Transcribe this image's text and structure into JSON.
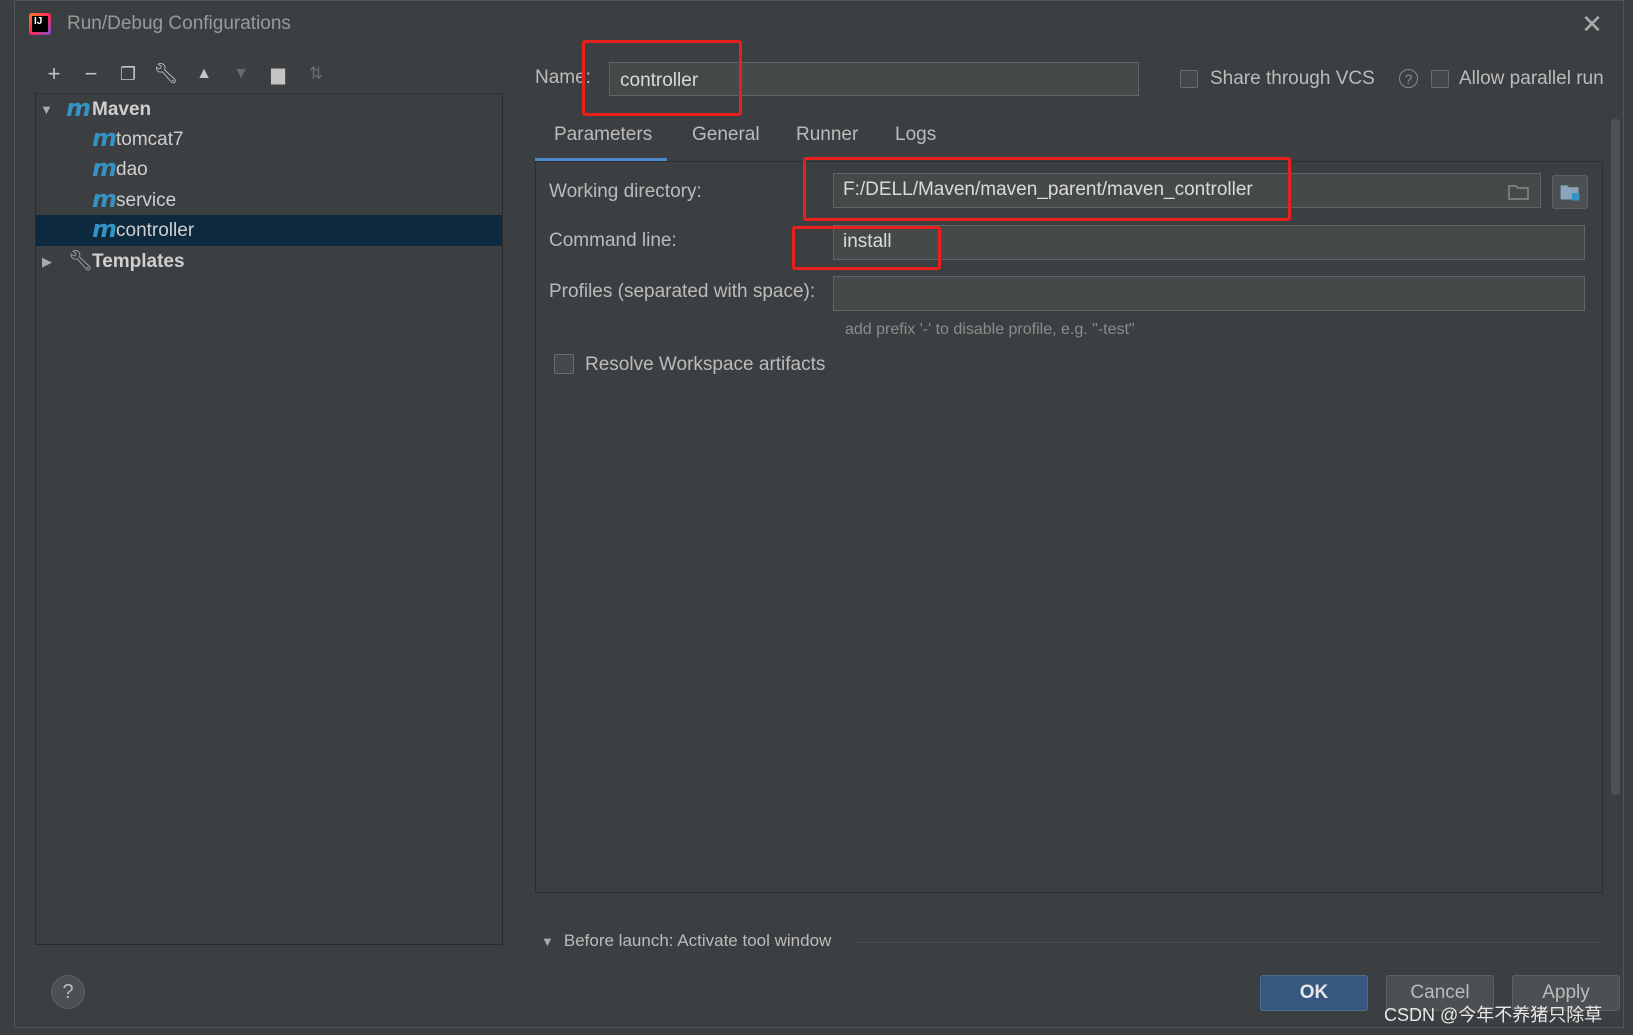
{
  "dialog": {
    "title": "Run/Debug Configurations",
    "app_icon_text": "IJ"
  },
  "toolbar": {
    "icons": [
      "plus-icon",
      "minus-icon",
      "copy-icon",
      "wrench-icon",
      "move-up-icon",
      "move-down-icon",
      "new-folder-icon",
      "sort-icon"
    ]
  },
  "tree": {
    "root": {
      "label": "Maven"
    },
    "children": [
      {
        "label": "tomcat7"
      },
      {
        "label": "dao"
      },
      {
        "label": "service"
      },
      {
        "label": "controller",
        "selected": true
      }
    ],
    "templates_label": "Templates"
  },
  "form": {
    "name_label": "Name:",
    "name_value": "controller",
    "share_vcs_label": "Share through VCS",
    "allow_parallel_label": "Allow parallel run"
  },
  "tabs": [
    "Parameters",
    "General",
    "Runner",
    "Logs"
  ],
  "parameters": {
    "working_dir_label": "Working directory:",
    "working_dir_value": "F:/DELL/Maven/maven_parent/maven_controller",
    "command_line_label": "Command line:",
    "command_line_value": "install",
    "profiles_label": "Profiles (separated with space):",
    "profiles_value": "",
    "profiles_hint": "add prefix '-' to disable profile, e.g. \"-test\"",
    "resolve_workspace_label": "Resolve Workspace artifacts"
  },
  "before_launch": "Before launch: Activate tool window",
  "buttons": {
    "ok": "OK",
    "cancel": "Cancel",
    "apply": "Apply",
    "help": "?"
  },
  "watermark": "CSDN @今年不养猪只除草",
  "colors": {
    "accent": "#4a88c7",
    "highlight": "#e8211c",
    "selected_row": "#0d293e",
    "maven_icon": "#3592c4"
  }
}
